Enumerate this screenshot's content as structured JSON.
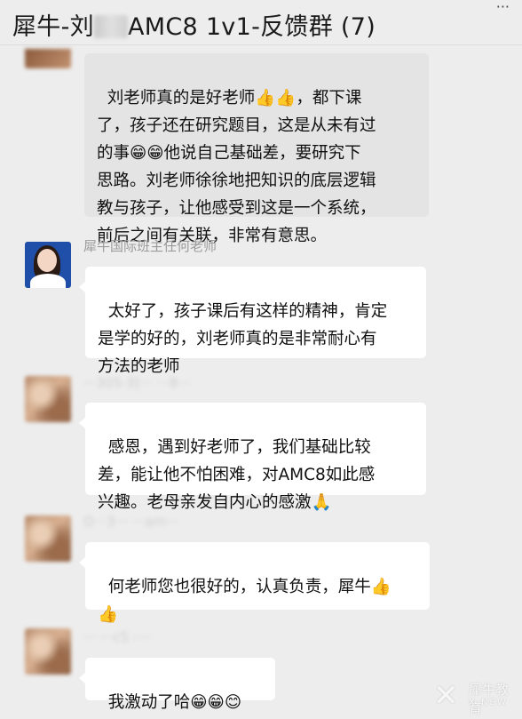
{
  "header": {
    "title_part1": "犀牛-刘",
    "title_part2": "AMC8 1v1-反馈群 (7)",
    "more": "···"
  },
  "messages": [
    {
      "text": "刘老师真的是好老师👍👍，都下课\n了，孩子还在研究题目，这是从未有过\n的事😁😁他说自己基础差，要研究下\n思路。刘老师徐徐地把知识的底层逻辑\n教与孩子，让他感受到这是一个系统，\n前后之间有关联，非常有意思。"
    },
    {
      "sender": "犀牛国际班主任何老师",
      "text": "太好了，孩子课后有这样的精神，肯定\n是学的好的，刘老师真的是非常耐心有\n方法的老师"
    },
    {
      "sender": "···305-刘···  ···8···",
      "text": "感恩，遇到好老师了，我们基础比较\n差，能让他不怕困难，对AMC8如此感\n兴趣。老母亲发自内心的感激🙏"
    },
    {
      "sender": "O···3···  ···am···",
      "text": "何老师您也很好的，认真负责，犀牛👍\n👍"
    },
    {
      "sender": "···  ···c5 -···",
      "text": "我激动了哈😁😁😊"
    }
  ],
  "watermark": {
    "mark": "✕",
    "text": "犀牛教育",
    "sub": "X-NEW"
  }
}
